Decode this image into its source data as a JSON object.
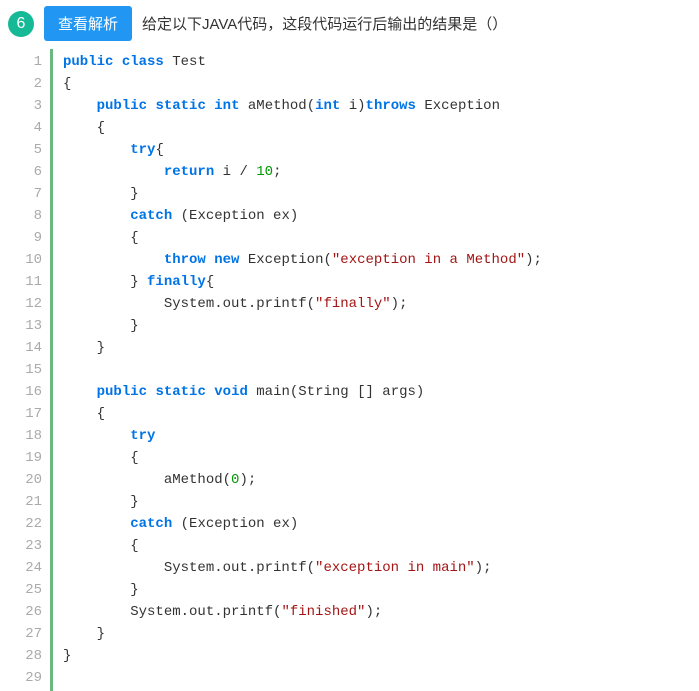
{
  "header": {
    "question_number": "6",
    "view_button": "查看解析",
    "question_text": "给定以下JAVA代码，这段代码运行后输出的结果是（）"
  },
  "code": {
    "lines": [
      {
        "n": "1",
        "t": [
          {
            "c": "kw",
            "s": "public"
          },
          {
            "s": " "
          },
          {
            "c": "kw",
            "s": "class"
          },
          {
            "s": " Test"
          }
        ]
      },
      {
        "n": "2",
        "t": [
          {
            "s": "{"
          }
        ]
      },
      {
        "n": "3",
        "t": [
          {
            "s": "    "
          },
          {
            "c": "kw",
            "s": "public"
          },
          {
            "s": " "
          },
          {
            "c": "kw",
            "s": "static"
          },
          {
            "s": " "
          },
          {
            "c": "kw",
            "s": "int"
          },
          {
            "s": " aMethod("
          },
          {
            "c": "kw",
            "s": "int"
          },
          {
            "s": " i)"
          },
          {
            "c": "kw",
            "s": "throws"
          },
          {
            "s": " Exception"
          }
        ]
      },
      {
        "n": "4",
        "t": [
          {
            "s": "    {"
          }
        ]
      },
      {
        "n": "5",
        "t": [
          {
            "s": "        "
          },
          {
            "c": "kw",
            "s": "try"
          },
          {
            "s": "{"
          }
        ]
      },
      {
        "n": "6",
        "t": [
          {
            "s": "            "
          },
          {
            "c": "kw",
            "s": "return"
          },
          {
            "s": " i / "
          },
          {
            "c": "num",
            "s": "10"
          },
          {
            "s": ";"
          }
        ]
      },
      {
        "n": "7",
        "t": [
          {
            "s": "        }"
          }
        ]
      },
      {
        "n": "8",
        "t": [
          {
            "s": "        "
          },
          {
            "c": "kw",
            "s": "catch"
          },
          {
            "s": " (Exception ex)"
          }
        ]
      },
      {
        "n": "9",
        "t": [
          {
            "s": "        {"
          }
        ]
      },
      {
        "n": "10",
        "t": [
          {
            "s": "            "
          },
          {
            "c": "kw",
            "s": "throw"
          },
          {
            "s": " "
          },
          {
            "c": "kw",
            "s": "new"
          },
          {
            "s": " Exception("
          },
          {
            "c": "str",
            "s": "\"exception in a Method\""
          },
          {
            "s": ");"
          }
        ]
      },
      {
        "n": "11",
        "t": [
          {
            "s": "        } "
          },
          {
            "c": "kw",
            "s": "finally"
          },
          {
            "s": "{"
          }
        ]
      },
      {
        "n": "12",
        "t": [
          {
            "s": "            System.out.printf("
          },
          {
            "c": "str",
            "s": "\"finally\""
          },
          {
            "s": ");"
          }
        ]
      },
      {
        "n": "13",
        "t": [
          {
            "s": "        }"
          }
        ]
      },
      {
        "n": "14",
        "t": [
          {
            "s": "    }"
          }
        ]
      },
      {
        "n": "15",
        "t": [
          {
            "s": ""
          }
        ]
      },
      {
        "n": "16",
        "t": [
          {
            "s": "    "
          },
          {
            "c": "kw",
            "s": "public"
          },
          {
            "s": " "
          },
          {
            "c": "kw",
            "s": "static"
          },
          {
            "s": " "
          },
          {
            "c": "kw",
            "s": "void"
          },
          {
            "s": " main(String [] args)"
          }
        ]
      },
      {
        "n": "17",
        "t": [
          {
            "s": "    {"
          }
        ]
      },
      {
        "n": "18",
        "t": [
          {
            "s": "        "
          },
          {
            "c": "kw",
            "s": "try"
          }
        ]
      },
      {
        "n": "19",
        "t": [
          {
            "s": "        {"
          }
        ]
      },
      {
        "n": "20",
        "t": [
          {
            "s": "            aMethod("
          },
          {
            "c": "num",
            "s": "0"
          },
          {
            "s": ");"
          }
        ]
      },
      {
        "n": "21",
        "t": [
          {
            "s": "        }"
          }
        ]
      },
      {
        "n": "22",
        "t": [
          {
            "s": "        "
          },
          {
            "c": "kw",
            "s": "catch"
          },
          {
            "s": " (Exception ex)"
          }
        ]
      },
      {
        "n": "23",
        "t": [
          {
            "s": "        {"
          }
        ]
      },
      {
        "n": "24",
        "t": [
          {
            "s": "            System.out.printf("
          },
          {
            "c": "str",
            "s": "\"exception in main\""
          },
          {
            "s": ");"
          }
        ]
      },
      {
        "n": "25",
        "t": [
          {
            "s": "        }"
          }
        ]
      },
      {
        "n": "26",
        "t": [
          {
            "s": "        System.out.printf("
          },
          {
            "c": "str",
            "s": "\"finished\""
          },
          {
            "s": ");"
          }
        ]
      },
      {
        "n": "27",
        "t": [
          {
            "s": "    }"
          }
        ]
      },
      {
        "n": "28",
        "t": [
          {
            "s": "}"
          }
        ]
      },
      {
        "n": "29",
        "t": [
          {
            "s": ""
          }
        ]
      }
    ]
  }
}
